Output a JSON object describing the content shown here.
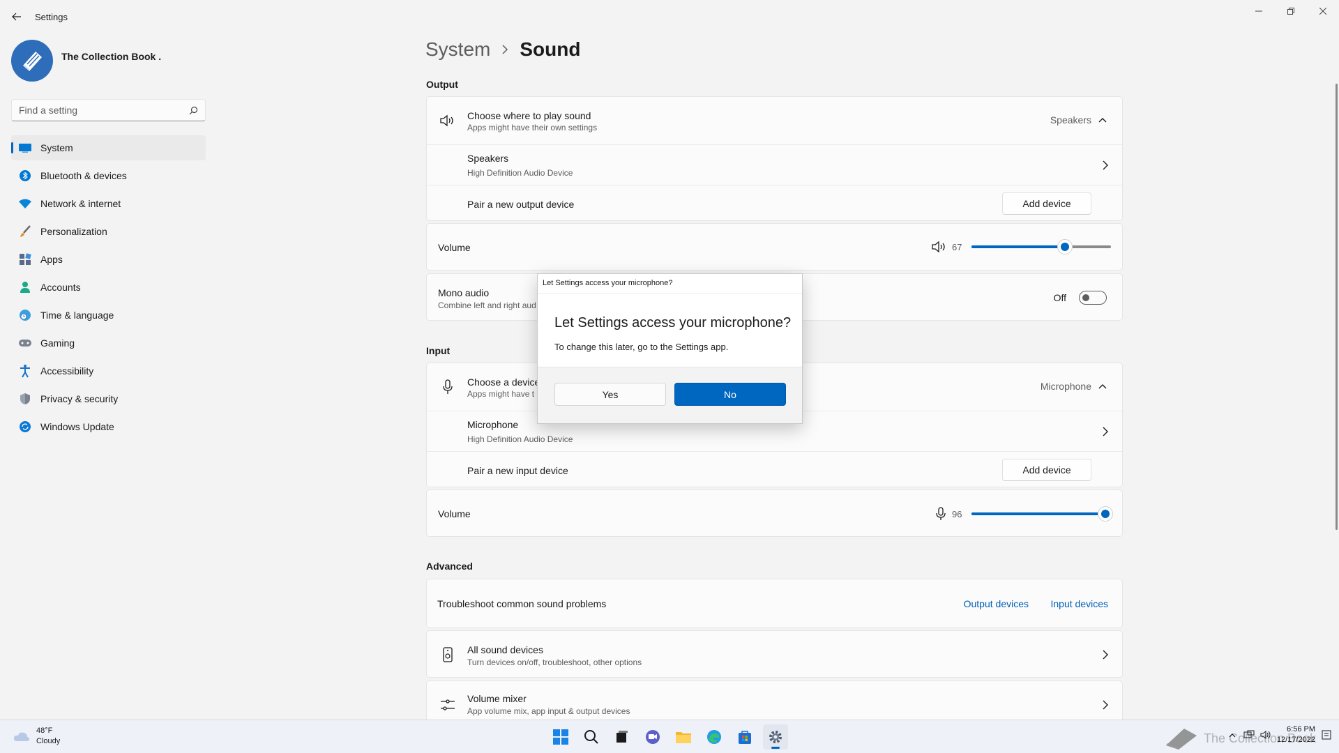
{
  "window": {
    "title": "Settings",
    "controls": {
      "minimize": "minimize",
      "restore": "restore",
      "close": "close"
    }
  },
  "user": {
    "name": "The Collection Book ."
  },
  "search": {
    "placeholder": "Find a setting",
    "value": ""
  },
  "nav": {
    "items": [
      {
        "label": "System",
        "icon": "monitor-icon",
        "active": true
      },
      {
        "label": "Bluetooth & devices",
        "icon": "bluetooth-icon"
      },
      {
        "label": "Network & internet",
        "icon": "wifi-icon"
      },
      {
        "label": "Personalization",
        "icon": "brush-icon"
      },
      {
        "label": "Apps",
        "icon": "apps-icon"
      },
      {
        "label": "Accounts",
        "icon": "person-icon"
      },
      {
        "label": "Time & language",
        "icon": "globe-clock-icon"
      },
      {
        "label": "Gaming",
        "icon": "gamepad-icon"
      },
      {
        "label": "Accessibility",
        "icon": "accessibility-icon"
      },
      {
        "label": "Privacy & security",
        "icon": "shield-icon"
      },
      {
        "label": "Windows Update",
        "icon": "update-icon"
      }
    ]
  },
  "breadcrumb": {
    "parent": "System",
    "current": "Sound"
  },
  "output": {
    "title": "Output",
    "choose": {
      "title": "Choose where to play sound",
      "subtitle": "Apps might have their own settings",
      "value": "Speakers"
    },
    "device": {
      "title": "Speakers",
      "subtitle": "High Definition Audio Device"
    },
    "pair": {
      "title": "Pair a new output device",
      "button": "Add device"
    },
    "volume": {
      "label": "Volume",
      "value": 67
    },
    "mono": {
      "title": "Mono audio",
      "subtitle": "Combine left and right aud",
      "state": "Off"
    }
  },
  "input": {
    "title": "Input",
    "choose": {
      "title": "Choose a device",
      "subtitle": "Apps might have t",
      "value": "Microphone"
    },
    "device": {
      "title": "Microphone",
      "subtitle": "High Definition Audio Device"
    },
    "pair": {
      "title": "Pair a new input device",
      "button": "Add device"
    },
    "volume": {
      "label": "Volume",
      "value": 96
    }
  },
  "advanced": {
    "title": "Advanced",
    "troubleshoot": {
      "title": "Troubleshoot common sound problems",
      "link1": "Output devices",
      "link2": "Input devices"
    },
    "all_devices": {
      "title": "All sound devices",
      "subtitle": "Turn devices on/off, troubleshoot, other options"
    },
    "mixer": {
      "title": "Volume mixer",
      "subtitle": "App volume mix, app input & output devices"
    }
  },
  "dialog": {
    "caption": "Let Settings access your microphone?",
    "heading": "Let Settings access your microphone?",
    "text": "To change this later, go to the Settings app.",
    "yes": "Yes",
    "no": "No"
  },
  "taskbar": {
    "weather": {
      "temp": "48°F",
      "condition": "Cloudy"
    },
    "apps": [
      "start-icon",
      "search-icon",
      "task-view-icon",
      "chat-icon",
      "file-explorer-icon",
      "edge-icon",
      "store-icon",
      "settings-icon"
    ],
    "clock": {
      "time": "6:56 PM",
      "date": "12/17/2022"
    },
    "watermark": "The Collection Book"
  },
  "colors": {
    "accent": "#0067c0",
    "link": "#005fb8"
  }
}
